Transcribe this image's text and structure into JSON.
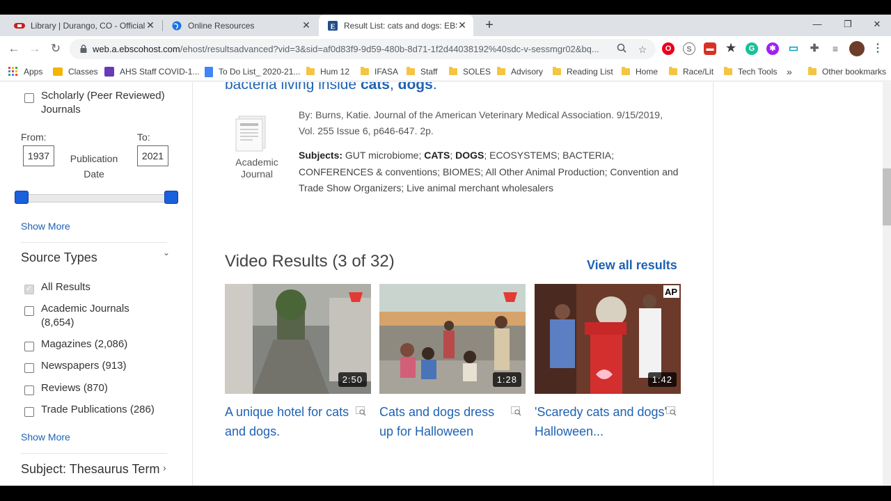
{
  "tabs": [
    {
      "title": "Library | Durango, CO - Official W",
      "favicon": "durango-favicon",
      "active": false
    },
    {
      "title": "Online Resources",
      "favicon": "globe-favicon",
      "active": false
    },
    {
      "title": "Result List: cats and dogs: EBSCO",
      "favicon": "ebsco-favicon",
      "active": true
    }
  ],
  "window": {
    "minimize": "—",
    "restore": "❐",
    "close": "✕"
  },
  "toolbar": {
    "url_host": "web.a.ebscohost.com",
    "url_rest": "/ehost/resultsadvanced?vid=3&sid=af0d83f9-9d59-480b-8d71-1f2d44038192%40sdc-v-sessmgr02&bq..."
  },
  "bookmarks": [
    {
      "label": "Apps",
      "icon": "apps-grid-icon"
    },
    {
      "label": "Classes",
      "icon": "classes-icon"
    },
    {
      "label": "AHS Staff COVID-1...",
      "icon": "forms-icon"
    },
    {
      "label": "To Do List_ 2020-21...",
      "icon": "docs-icon"
    },
    {
      "label": "Hum 12",
      "icon": "folder-icon"
    },
    {
      "label": "IFASA",
      "icon": "folder-icon"
    },
    {
      "label": "Staff",
      "icon": "folder-icon"
    },
    {
      "label": "SOLES",
      "icon": "folder-icon"
    },
    {
      "label": "Advisory",
      "icon": "folder-icon"
    },
    {
      "label": "Reading List",
      "icon": "folder-icon"
    },
    {
      "label": "Home",
      "icon": "folder-icon"
    },
    {
      "label": "Race/Lit",
      "icon": "folder-icon"
    },
    {
      "label": "Tech Tools",
      "icon": "folder-icon"
    },
    {
      "label": "»",
      "icon": ""
    },
    {
      "label": "Other bookmarks",
      "icon": "folder-icon"
    }
  ],
  "sidebar": {
    "scholarly": "Scholarly (Peer Reviewed) Journals",
    "from_label": "From:",
    "to_label": "To:",
    "from_value": "1937",
    "to_value": "2021",
    "pub_date": "Publication Date",
    "show_more_1": "Show More",
    "source_types_title": "Source Types",
    "source_types": [
      {
        "label": "All Results",
        "checked": true
      },
      {
        "label": "Academic Journals (8,654)",
        "checked": false
      },
      {
        "label": "Magazines (2,086)",
        "checked": false
      },
      {
        "label": "Newspapers (913)",
        "checked": false
      },
      {
        "label": "Reviews (870)",
        "checked": false
      },
      {
        "label": "Trade Publications (286)",
        "checked": false
      }
    ],
    "show_more_2": "Show More",
    "subject_title": "Subject: Thesaurus Term"
  },
  "result": {
    "title_pre": "bacteria living inside ",
    "title_b1": "cats",
    "title_mid": ", ",
    "title_b2": "dogs",
    "title_post": ".",
    "doc_type": "Academic Journal",
    "meta": "By: Burns, Katie. Journal of the American Veterinary Medical Association. 9/15/2019, Vol. 255 Issue 6, p646-647. 2p.",
    "subjects_label": "Subjects:",
    "subjects_1": " GUT microbiome; ",
    "subjects_b1": "CATS",
    "subjects_2": "; ",
    "subjects_b2": "DOGS",
    "subjects_3": "; ECOSYSTEMS; BACTERIA; CONFERENCES & conventions; BIOMES; All Other Animal Production; Convention and Trade Show Organizers; Live animal merchant wholesalers"
  },
  "videos": {
    "heading": "Video Results (3 of 32)",
    "view_all": "View all results",
    "items": [
      {
        "title": "A unique hotel for cats and dogs.",
        "duration": "2:50"
      },
      {
        "title": "Cats and dogs dress up for Halloween",
        "duration": "1:28"
      },
      {
        "title": "'Scaredy cats and dogs' Halloween...",
        "duration": "1:42"
      }
    ]
  }
}
